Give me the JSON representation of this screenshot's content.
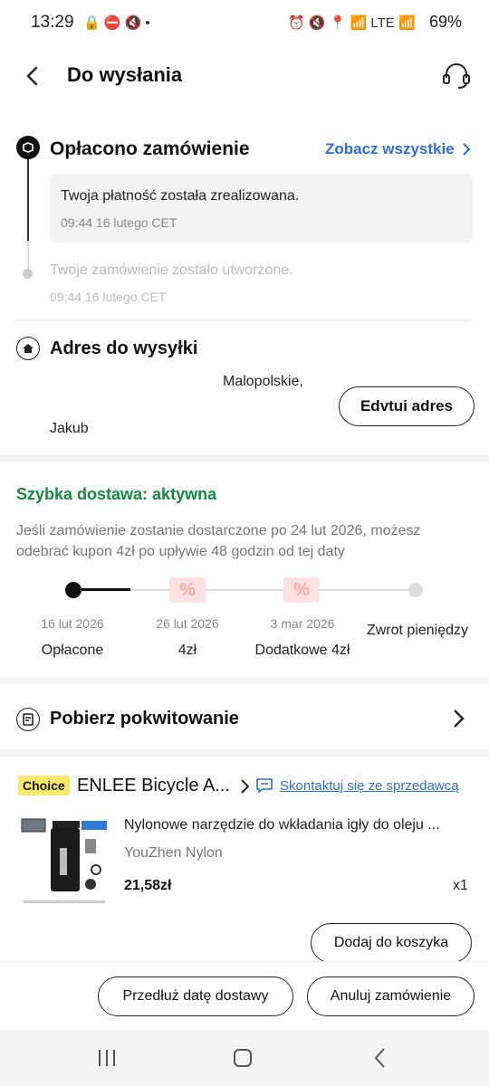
{
  "status": {
    "time": "13:29",
    "battery": "69%"
  },
  "header": {
    "title": "Do wysłania"
  },
  "timeline": {
    "paid_title": "Opłacono zamówienie",
    "see_all": "Zobacz wszystkie",
    "payment_msg": "Twoja płatność została zrealizowana.",
    "payment_time": "09:44 16 lutego CET",
    "created_msg": "Twoje zamówienie zostało utworzone.",
    "created_time": "09:44 16 lutego CET"
  },
  "address": {
    "title": "Adres do wysyłki",
    "region": "Malopolskie,",
    "name": "Jakub",
    "edit_button": "Edvtui adres"
  },
  "delivery": {
    "title": "Szybka dostawa: aktywna",
    "desc": "Jeśli zamówienie zostanie dostarczone po 24 lut 2026, możesz odebrać kupon 4zł po upływie 48 godzin od tej daty",
    "steps": [
      {
        "date": "16 lut 2026",
        "label": "Opłacone"
      },
      {
        "date": "26 lut 2026",
        "label": "4zł"
      },
      {
        "date": "3 mar 2026",
        "label": "Dodatkowe 4zł"
      },
      {
        "date": "",
        "label": "Zwrot pieniędzy"
      }
    ]
  },
  "receipt": {
    "label": "Pobierz pokwitowanie"
  },
  "store": {
    "badge": "Choice",
    "name": "ENLEE Bicycle A...",
    "contact": "Skontaktuj się ze sprzedawcą"
  },
  "product": {
    "title": "Nylonowe narzędzie do wkładania igły do oleju ...",
    "variant": "YouZhen Nylon",
    "price": "21,58zł",
    "qty": "x1",
    "add_to_cart": "Dodaj do koszyka"
  },
  "actions": {
    "extend": "Przedłuż datę dostawy",
    "cancel": "Anuluj zamówienie"
  },
  "colors": {
    "accent_blue": "#2a6fdb",
    "green": "#128c3c",
    "coupon_pink": "#f9a7a7"
  }
}
